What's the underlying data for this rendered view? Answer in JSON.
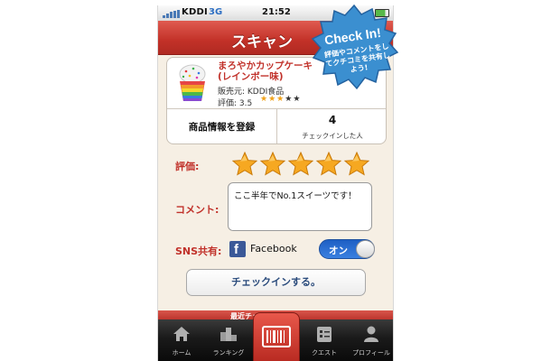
{
  "status_bar": {
    "carrier": "KDDI",
    "network": "3G",
    "time": "21:52"
  },
  "nav": {
    "title": "スキャン"
  },
  "badge": {
    "title": "Check In!",
    "subtitle": "評価やコメントをしてクチコミを共有しよう!"
  },
  "product": {
    "name_line1": "まろやかカップケーキ",
    "name_line2": "(レインボー味)",
    "seller": "販売元: KDDI食品",
    "rating_label": "評価: 3.5",
    "rating_value": 3.5,
    "rating_max": 5
  },
  "actions": {
    "register_label": "商品情報を登録",
    "checkin_count": "4",
    "checkin_count_label": "チェックインした人"
  },
  "form": {
    "rating_label": "評価:",
    "rating_selected": 5,
    "comment_label": "コメント:",
    "comment_value": "ここ半年でNo.1スイーツです！",
    "sns_label": "SNS共有:",
    "sns_service": "Facebook",
    "sns_toggle": "オン",
    "submit_label": "チェックインする。"
  },
  "recent": {
    "label": "最近チェックイン"
  },
  "tabbar": {
    "items": [
      {
        "label": "ホーム",
        "icon": "home-icon"
      },
      {
        "label": "ランキング",
        "icon": "ranking-icon"
      },
      {
        "label": "",
        "icon": "barcode-icon"
      },
      {
        "label": "クエスト",
        "icon": "quest-icon"
      },
      {
        "label": "プロフィール",
        "icon": "profile-icon"
      }
    ]
  },
  "colors": {
    "brand_red": "#c23128",
    "badge_blue": "#3b8fd0",
    "star_gold": "#f1a21a",
    "toggle_blue": "#2a6fd0",
    "facebook": "#3b5998"
  }
}
